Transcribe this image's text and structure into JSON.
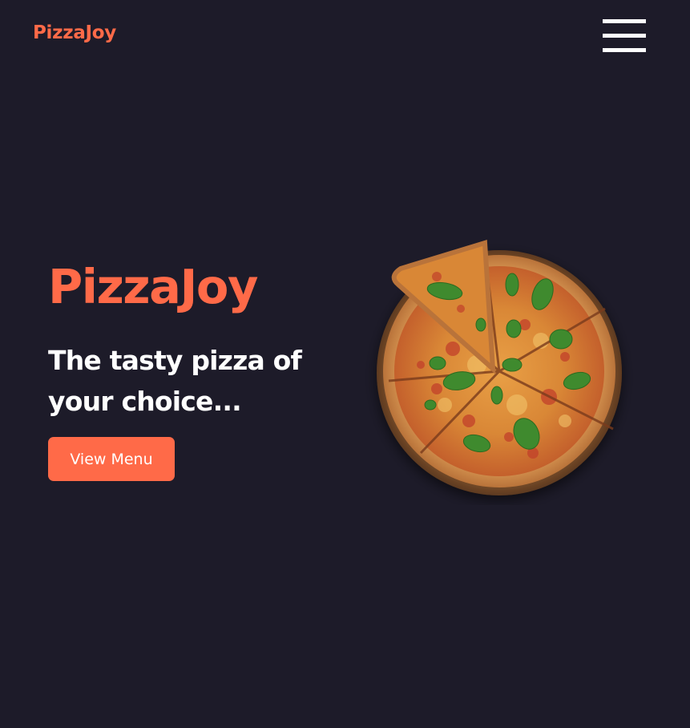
{
  "header": {
    "brand": "PizzaJoy",
    "menu_icon": "hamburger-menu-icon"
  },
  "hero": {
    "title": "PizzaJoy",
    "subtitle": "The tasty pizza of your choice...",
    "cta_label": "View Menu",
    "image": "pizza-image"
  },
  "colors": {
    "background": "#1d1b29",
    "accent": "#ff6a48",
    "text": "#ffffff"
  }
}
